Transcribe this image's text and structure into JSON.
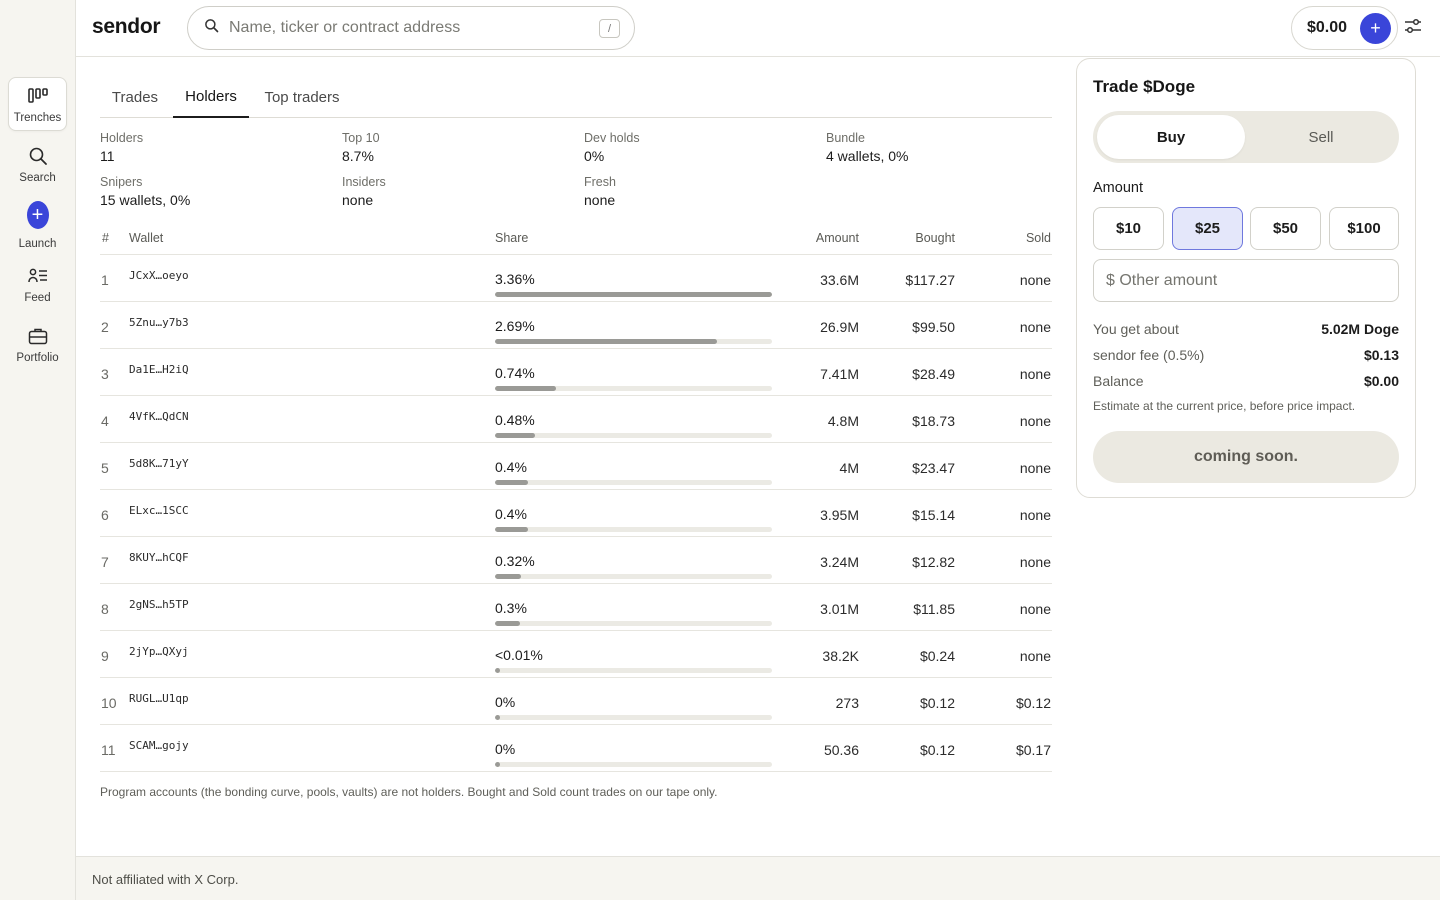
{
  "brand": "sendor",
  "search": {
    "placeholder": "Name, ticker or contract address",
    "shortcut": "/"
  },
  "header": {
    "balance": "$0.00"
  },
  "rail": [
    {
      "label": "Trenches",
      "icon": "trenches-icon"
    },
    {
      "label": "Search",
      "icon": "search-icon"
    },
    {
      "label": "Launch",
      "icon": "plus-icon"
    },
    {
      "label": "Feed",
      "icon": "feed-icon"
    },
    {
      "label": "Portfolio",
      "icon": "briefcase-icon"
    }
  ],
  "tabs": [
    "Trades",
    "Holders",
    "Top traders"
  ],
  "active_tab": "Holders",
  "stats": [
    {
      "label": "Holders",
      "value": "11"
    },
    {
      "label": "Top 10",
      "value": "8.7%"
    },
    {
      "label": "Dev holds",
      "value": "0%"
    },
    {
      "label": "Bundle",
      "value": "4 wallets, 0%"
    },
    {
      "label": "Snipers",
      "value": "15 wallets, 0%"
    },
    {
      "label": "Insiders",
      "value": "none"
    },
    {
      "label": "Fresh",
      "value": "none"
    }
  ],
  "table": {
    "headers": {
      "rank": "#",
      "wallet": "Wallet",
      "share": "Share",
      "amount": "Amount",
      "bought": "Bought",
      "sold": "Sold"
    },
    "rows": [
      {
        "rank": "1",
        "wallet": "JCxX…oeyo",
        "share": "3.36%",
        "share_value": 3.36,
        "amount": "33.6M",
        "bought": "$117.27",
        "sold": "none"
      },
      {
        "rank": "2",
        "wallet": "5Znu…y7b3",
        "share": "2.69%",
        "share_value": 2.69,
        "amount": "26.9M",
        "bought": "$99.50",
        "sold": "none"
      },
      {
        "rank": "3",
        "wallet": "Da1E…H2iQ",
        "share": "0.74%",
        "share_value": 0.74,
        "amount": "7.41M",
        "bought": "$28.49",
        "sold": "none"
      },
      {
        "rank": "4",
        "wallet": "4VfK…QdCN",
        "share": "0.48%",
        "share_value": 0.48,
        "amount": "4.8M",
        "bought": "$18.73",
        "sold": "none"
      },
      {
        "rank": "5",
        "wallet": "5d8K…71yY",
        "share": "0.4%",
        "share_value": 0.4,
        "amount": "4M",
        "bought": "$23.47",
        "sold": "none"
      },
      {
        "rank": "6",
        "wallet": "ELxc…1SCC",
        "share": "0.4%",
        "share_value": 0.4,
        "amount": "3.95M",
        "bought": "$15.14",
        "sold": "none"
      },
      {
        "rank": "7",
        "wallet": "8KUY…hCQF",
        "share": "0.32%",
        "share_value": 0.32,
        "amount": "3.24M",
        "bought": "$12.82",
        "sold": "none"
      },
      {
        "rank": "8",
        "wallet": "2gNS…h5TP",
        "share": "0.3%",
        "share_value": 0.3,
        "amount": "3.01M",
        "bought": "$11.85",
        "sold": "none"
      },
      {
        "rank": "9",
        "wallet": "2jYp…QXyj",
        "share": "<0.01%",
        "share_value": 0.005,
        "amount": "38.2K",
        "bought": "$0.24",
        "sold": "none"
      },
      {
        "rank": "10",
        "wallet": "RUGL…U1qp",
        "share": "0%",
        "share_value": 0,
        "amount": "273",
        "bought": "$0.12",
        "sold": "$0.12"
      },
      {
        "rank": "11",
        "wallet": "SCAM…gojy",
        "share": "0%",
        "share_value": 0,
        "amount": "50.36",
        "bought": "$0.12",
        "sold": "$0.17"
      }
    ],
    "footnote": "Program accounts (the bonding curve, pools, vaults) are not holders. Bought and Sold count trades on our tape only."
  },
  "trade": {
    "title": "Trade $Doge",
    "buy_label": "Buy",
    "sell_label": "Sell",
    "amount_label": "Amount",
    "presets": [
      "$10",
      "$25",
      "$50",
      "$100"
    ],
    "selected_preset": "$25",
    "other_placeholder": "$ Other amount",
    "you_get_label": "You get about",
    "you_get_value": "5.02M Doge",
    "fee_label": "sendor fee (0.5%)",
    "fee_value": "$0.13",
    "balance_label": "Balance",
    "balance_value": "$0.00",
    "estimate_note": "Estimate at the current price, before price impact.",
    "cta_label": "coming soon."
  },
  "footer": {
    "text": "Not affiliated with X Corp."
  },
  "colors": {
    "accent": "#3a45d9",
    "background_rail": "#f6f5f0",
    "bar_fill": "#9a9a96",
    "selected_chip": "#e4e7fa"
  }
}
